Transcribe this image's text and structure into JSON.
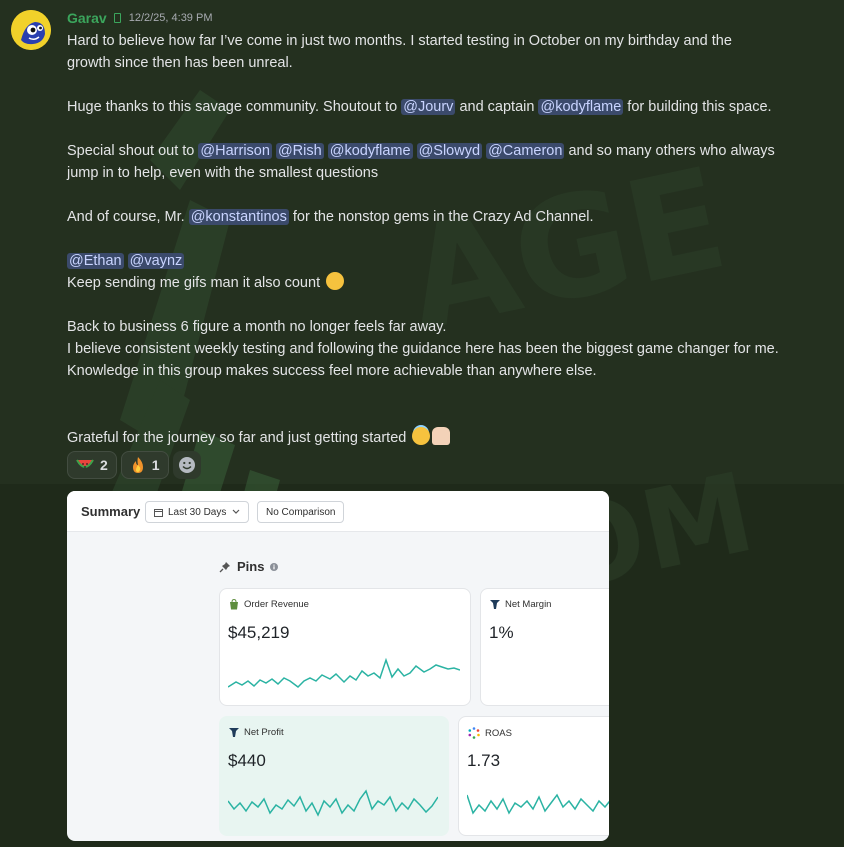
{
  "message": {
    "author": "Garav",
    "timestamp": "12/2/25, 4:39 PM",
    "lines": {
      "l1": "Hard to believe how far I’ve come in just two months. I started testing in October on my birthday and the",
      "l2": "growth since then has been unreal.",
      "l3a": "Huge thanks to this savage community. Shoutout to ",
      "m_jourv": "@Jourv",
      "l3b": "  and  captain ",
      "m_kody1": "@kodyflame",
      "l3c": " for building this space.",
      "l4a": "Special shout out to ",
      "m_harrison": "@Harrison",
      "m_rish": "@Rish",
      "m_kody2": "@kodyflame",
      "m_slowyd": "@Slowyd",
      "m_cameron": "@Cameron",
      "l4b": " and so many others who always",
      "l5": "jump in to help, even with the smallest questions",
      "l6a": "And of course, Mr. ",
      "m_konst": "@konstantinos",
      "l6b": "  for the nonstop gems in the Crazy Ad Channel.",
      "m_ethan": "@Ethan",
      "m_vaynz": "@vaynz",
      "l7": "Keep sending me gifs man it also count",
      "l8": "Back to business 6 figure a month no longer feels far away.",
      "l9": "I believe consistent weekly testing and following the guidance here has been the biggest game changer for me.",
      "l10": "Knowledge in this group makes success feel more achievable than anywhere else.",
      "l11": "Grateful for the journey so far and just getting started"
    },
    "emojis": [
      "rolling-on-floor-laughing",
      "smiling-face-with-halo",
      "folded-hands"
    ],
    "reactions": [
      {
        "emoji": "watermelon",
        "count": "2"
      },
      {
        "emoji": "fire",
        "count": "1"
      }
    ]
  },
  "attachment": {
    "summary_label": "Summary",
    "date_range": "Last 30 Days",
    "comparison": "No Comparison",
    "pins_label": "Pins",
    "tiles": [
      {
        "title": "Order Revenue",
        "value": "$45,219"
      },
      {
        "title": "Net Margin",
        "value": "1%"
      },
      {
        "title": "Net Profit",
        "value": "$440"
      },
      {
        "title": "ROAS",
        "value": "1.73"
      }
    ]
  },
  "colors": {
    "background": "#24301f",
    "username": "#3ba55c",
    "mention_bg": "#3b4a6b",
    "mention_text": "#c9d4ff",
    "sparkline": "#2bb3a3"
  }
}
